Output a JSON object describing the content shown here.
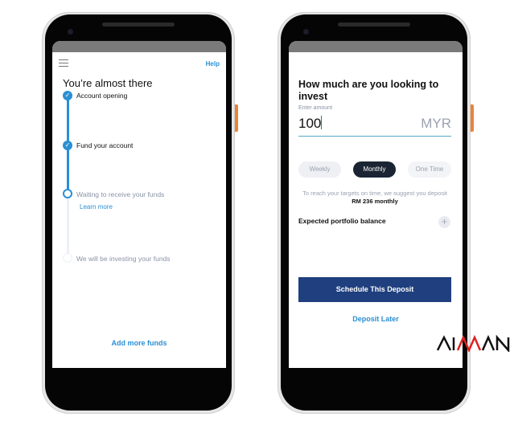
{
  "left_screen": {
    "menu_icon": "hamburger-icon",
    "help_label": "Help",
    "title": "You’re almost there",
    "steps": [
      {
        "label": "Account opening",
        "state": "done"
      },
      {
        "label": "Fund your account",
        "state": "done"
      },
      {
        "label": "Waiting to receive your funds",
        "state": "current"
      },
      {
        "label": "We will be investing your funds",
        "state": "pending"
      }
    ],
    "learn_more": "Learn more",
    "add_more_funds": "Add more funds"
  },
  "right_screen": {
    "title": "How much are you looking to invest",
    "amount_label": "Enter amount",
    "amount_value": "100",
    "currency": "MYR",
    "frequency_options": [
      "Weekly",
      "Monthly",
      "One Time"
    ],
    "selected_frequency": "Monthly",
    "suggestion_text": "To reach your targets on time, we suggest you deposit",
    "suggestion_amount": "RM 236 monthly",
    "expected_balance_label": "Expected portfolio balance",
    "expand_icon": "plus-icon",
    "schedule_button": "Schedule This Deposit",
    "deposit_later": "Deposit Later"
  },
  "logo": "AIMAN",
  "colors": {
    "accent": "#2a8fd4",
    "primary_button": "#1f3f7e",
    "selected_pill": "#1b2433",
    "side_button": "#e8843a"
  }
}
